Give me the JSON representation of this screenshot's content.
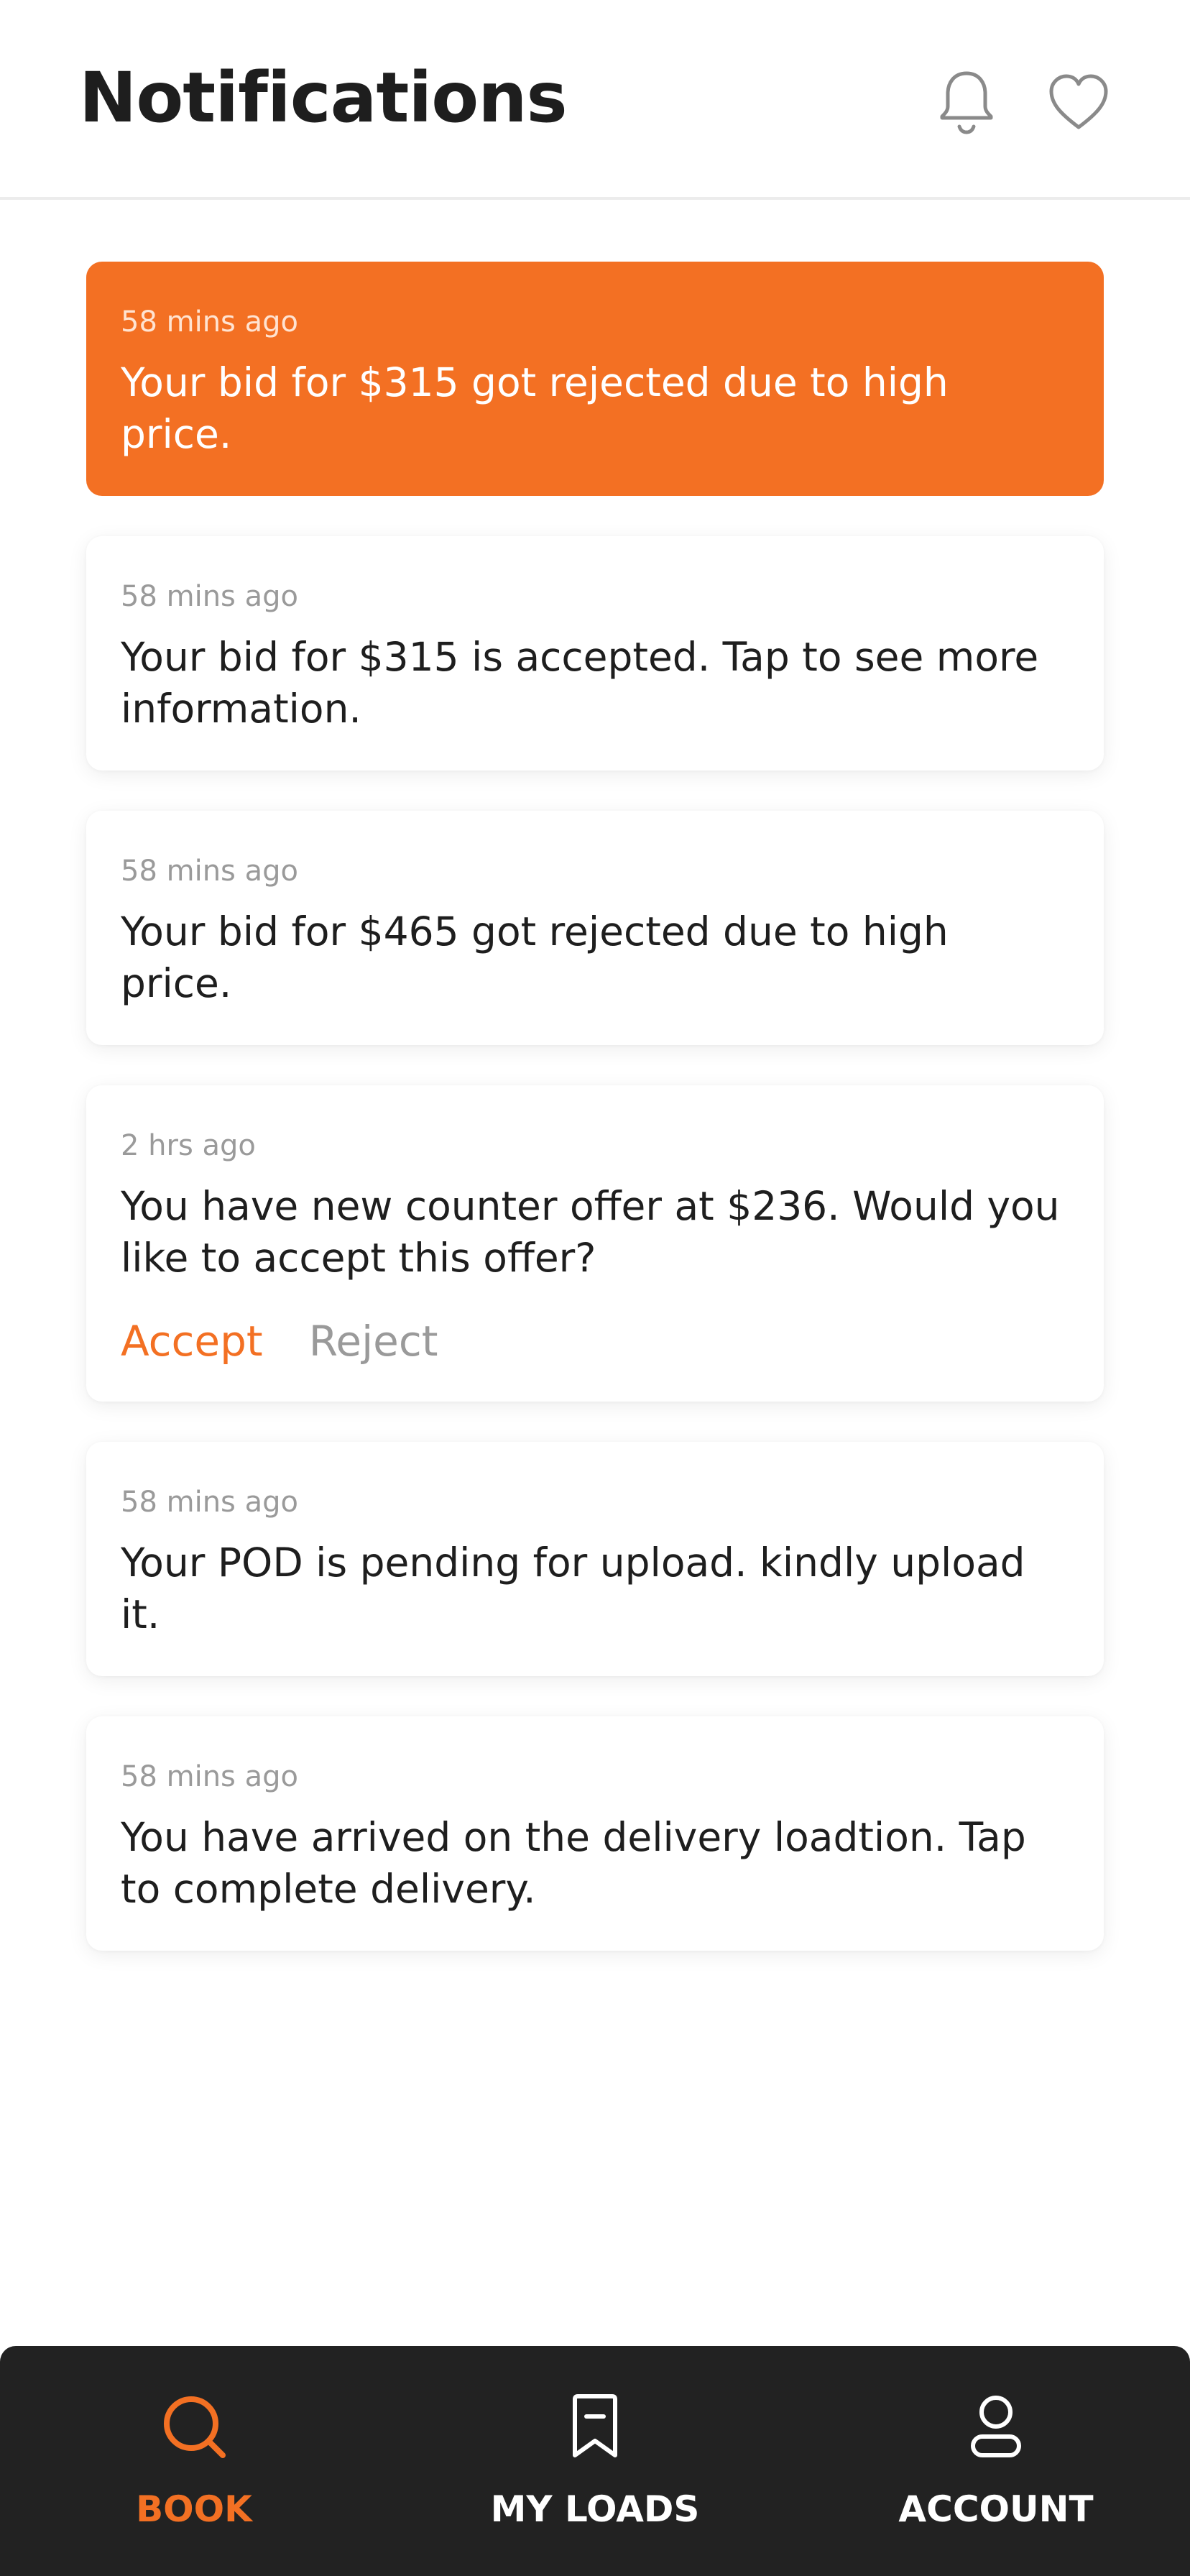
{
  "header": {
    "title": "Notifications",
    "icons": [
      "bell-icon",
      "heart-icon"
    ]
  },
  "notifications": [
    {
      "time": "58 mins ago",
      "message": "Your bid for $315 got rejected due to high price.",
      "highlighted": true
    },
    {
      "time": "58 mins ago",
      "message": "Your bid for $315 is accepted. Tap to see more information."
    },
    {
      "time": "58 mins ago",
      "message": "Your bid for $465 got rejected due to high price."
    },
    {
      "time": "2 hrs ago",
      "message": "You have new counter offer at $236. Would you like to accept this offer?",
      "actions": {
        "accept": "Accept",
        "reject": "Reject"
      }
    },
    {
      "time": "58 mins ago",
      "message": "Your POD is pending for upload. kindly upload it."
    },
    {
      "time": "58 mins ago",
      "message": "You have arrived on the delivery loadtion. Tap to complete delivery."
    }
  ],
  "bottom_nav": {
    "items": [
      {
        "label": "BOOK",
        "icon": "search-icon",
        "active": true
      },
      {
        "label": "MY LOADS",
        "icon": "bookmark-icon"
      },
      {
        "label": "ACCOUNT",
        "icon": "user-icon"
      }
    ]
  },
  "colors": {
    "accent": "#f37023",
    "nav_background": "#222222",
    "text_primary": "#1e1e1e",
    "text_muted": "#9a9a9a"
  }
}
